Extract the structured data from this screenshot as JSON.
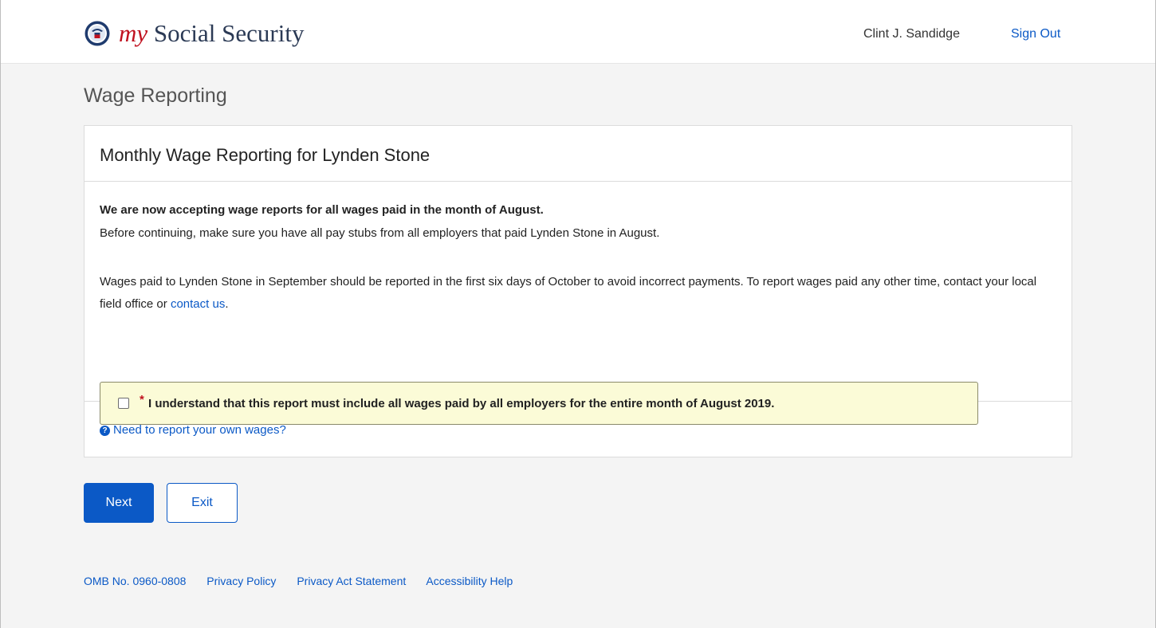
{
  "header": {
    "logo_prefix": "my",
    "logo_suffix": " Social Security",
    "user_name": "Clint J. Sandidge",
    "signout_label": "Sign Out"
  },
  "page": {
    "heading": "Wage Reporting"
  },
  "card": {
    "title": "Monthly Wage Reporting for Lynden Stone",
    "intro_bold": "We are now accepting wage reports for all wages paid in the month of August.",
    "intro_line": "Before continuing, make sure you have all pay stubs from all employers that paid Lynden Stone in August.",
    "para_text": "Wages paid to Lynden Stone in September should be reported in the first six days of October to avoid incorrect payments. To report wages paid any other time, contact your local field office or ",
    "para_link": "contact us",
    "para_end": ".",
    "ack_required_mark": "*",
    "ack_text": "I understand that this report must include all wages paid by all employers for the entire month of August 2019.",
    "ack_checked": false,
    "help_icon_glyph": "?",
    "help_link": "Need to report your own wages?"
  },
  "buttons": {
    "next_label": "Next",
    "exit_label": "Exit"
  },
  "footer": {
    "links": [
      "OMB No. 0960-0808",
      "Privacy Policy",
      "Privacy Act Statement",
      "Accessibility Help"
    ]
  },
  "colors": {
    "accent": "#0b59c6",
    "brand_red": "#c0111f",
    "ack_background": "#fbfbd7"
  },
  "icons": {
    "seal": "ssa-seal-icon",
    "help": "question-circle-icon"
  }
}
